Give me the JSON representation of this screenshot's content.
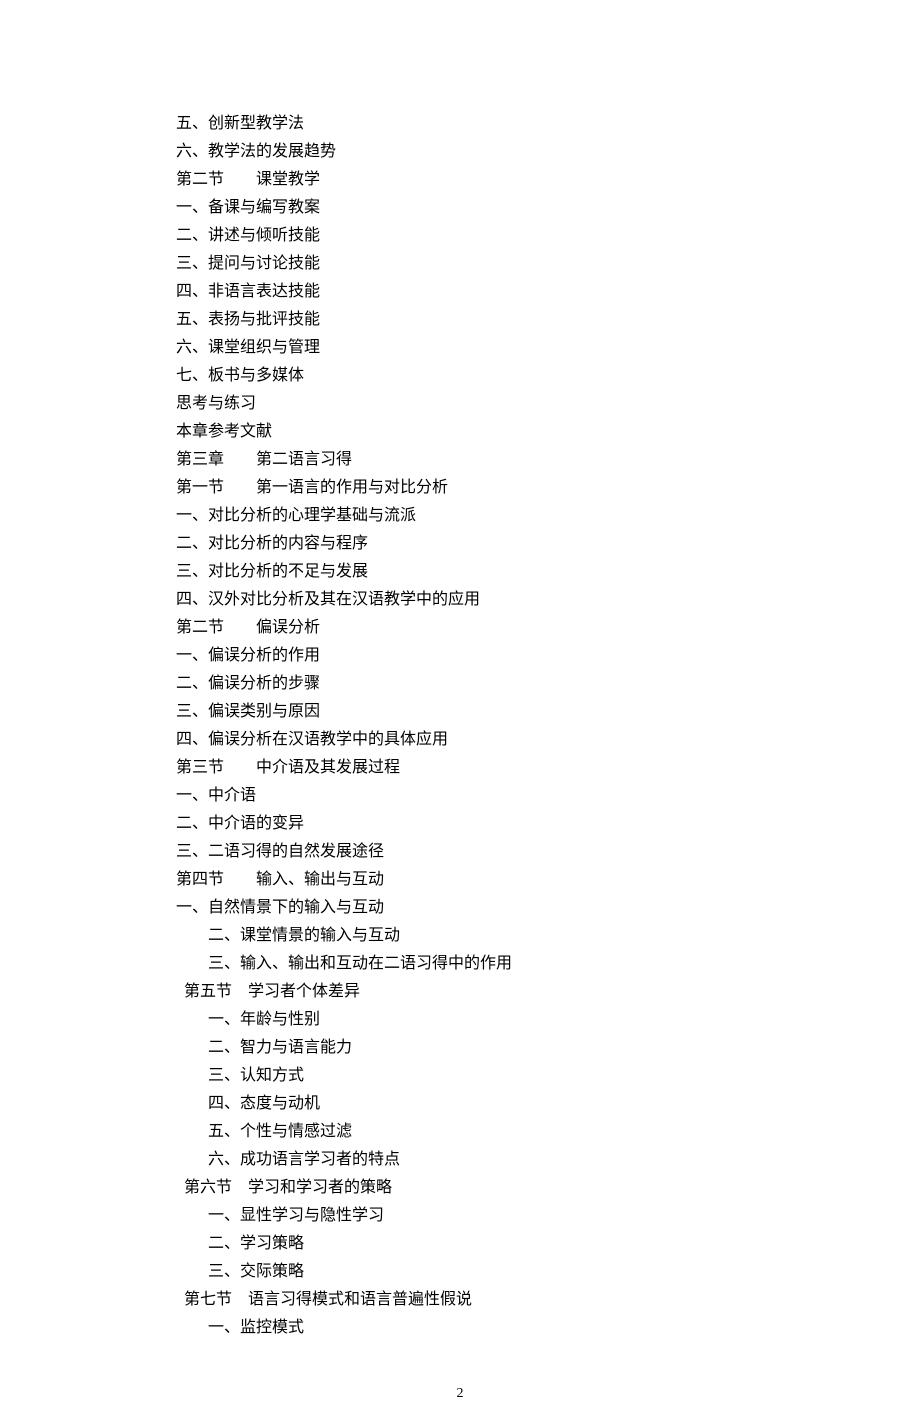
{
  "lines": [
    {
      "text": "五、创新型教学法",
      "indent": 0
    },
    {
      "text": "六、教学法的发展趋势",
      "indent": 0
    },
    {
      "text": " 第二节　　课堂教学",
      "indent": 0
    },
    {
      "text": " 一、备课与编写教案",
      "indent": 0
    },
    {
      "text": "二、讲述与倾听技能",
      "indent": 0
    },
    {
      "text": "三、提问与讨论技能",
      "indent": 0
    },
    {
      "text": "四、非语言表达技能",
      "indent": 0
    },
    {
      "text": "五、表扬与批评技能",
      "indent": 0
    },
    {
      "text": "六、课堂组织与管理",
      "indent": 0
    },
    {
      "text": "七、板书与多媒体",
      "indent": 0
    },
    {
      "text": " 思考与练习",
      "indent": 0
    },
    {
      "text": "本章参考文献",
      "indent": 0
    },
    {
      "text": "第三章　　第二语言习得",
      "indent": 0
    },
    {
      "text": "第一节　　第一语言的作用与对比分析",
      "indent": 0
    },
    {
      "text": "一、对比分析的心理学基础与流派",
      "indent": 0
    },
    {
      "text": "二、对比分析的内容与程序",
      "indent": 0
    },
    {
      "text": "三、对比分析的不足与发展",
      "indent": 0
    },
    {
      "text": "四、汉外对比分析及其在汉语教学中的应用",
      "indent": 0
    },
    {
      "text": " 第二节　　偏误分析",
      "indent": 0
    },
    {
      "text": " 一、偏误分析的作用",
      "indent": 0
    },
    {
      "text": " 二、偏误分析的步骤",
      "indent": 0
    },
    {
      "text": "三、偏误类别与原因",
      "indent": 0
    },
    {
      "text": "四、偏误分析在汉语教学中的具体应用",
      "indent": 0
    },
    {
      "text": " 第三节　　中介语及其发展过程",
      "indent": 0
    },
    {
      "text": " 一、中介语",
      "indent": 0
    },
    {
      "text": " 二、中介语的变异",
      "indent": 0
    },
    {
      "text": "三、二语习得的自然发展途径",
      "indent": 0
    },
    {
      "text": " 第四节　　输入、输出与互动",
      "indent": 0
    },
    {
      "text": " 一、自然情景下的输入与互动",
      "indent": 0
    },
    {
      "text": "二、课堂情景的输入与互动",
      "indent": 2
    },
    {
      "text": "三、输入、输出和互动在二语习得中的作用",
      "indent": 2
    },
    {
      "text": "第五节　学习者个体差异",
      "indent": 1
    },
    {
      "text": "一、年龄与性别",
      "indent": 2
    },
    {
      "text": "二、智力与语言能力",
      "indent": 2
    },
    {
      "text": "三、认知方式",
      "indent": 2
    },
    {
      "text": "四、态度与动机",
      "indent": 2
    },
    {
      "text": "五、个性与情感过滤",
      "indent": 2
    },
    {
      "text": "六、成功语言学习者的特点",
      "indent": 2
    },
    {
      "text": "第六节　学习和学习者的策略",
      "indent": 1
    },
    {
      "text": "一、显性学习与隐性学习",
      "indent": 2
    },
    {
      "text": "二、学习策略",
      "indent": 2
    },
    {
      "text": "三、交际策略",
      "indent": 2
    },
    {
      "text": "第七节　语言习得模式和语言普遍性假说",
      "indent": 1
    },
    {
      "text": "一、监控模式",
      "indent": 2
    }
  ],
  "page_number": "2"
}
